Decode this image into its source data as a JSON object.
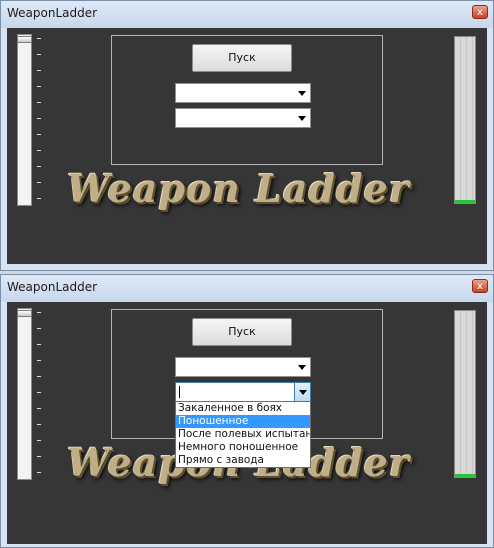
{
  "window": {
    "title": "WeaponLadder",
    "close_symbol": "x"
  },
  "main": {
    "start_label": "Пуск",
    "logo_text": "Weapon Ladder",
    "combo_first_value": "",
    "combo_second_value": "",
    "meter_level_fraction": 0.02
  },
  "dropdown": {
    "options": [
      "Закаленное в боях",
      "Поношенное",
      "После полевых испытаний",
      "Немного поношенное",
      "Прямо с завода"
    ],
    "highlighted_option": "Поношенное"
  }
}
